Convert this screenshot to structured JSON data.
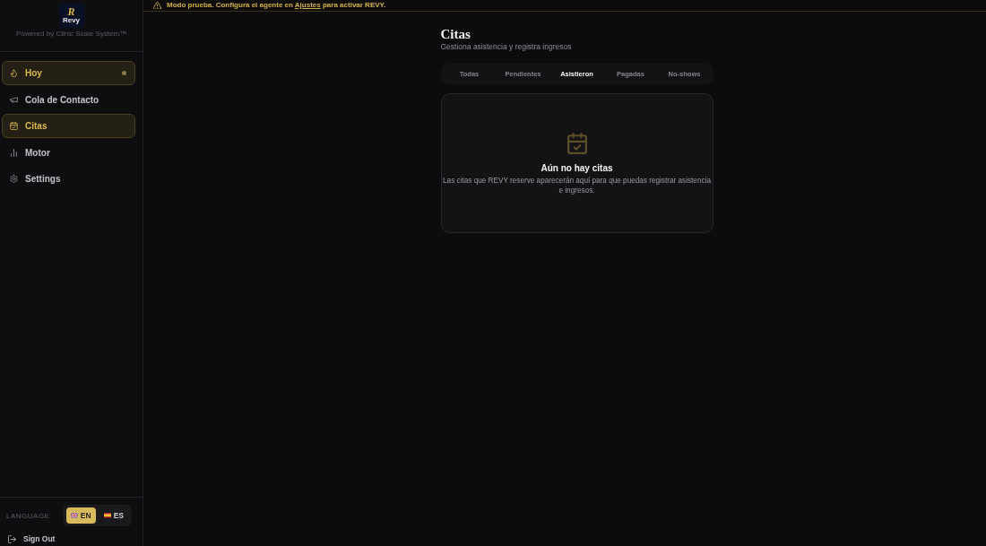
{
  "banner": {
    "message": "**Modo prueba.** Configura el agente en",
    "link": "Ajustes",
    "message_end": "para activar REVY."
  },
  "sidebar": {
    "logo": {
      "mark": "R",
      "name": "Revy"
    },
    "powered_by": "Powered by Clinic Scale System™",
    "nav": [
      {
        "label": "Hoy",
        "selected": true,
        "indicator": true
      },
      {
        "label": "Cola de Contacto",
        "selected": false,
        "indicator": false
      },
      {
        "label": "Citas",
        "selected": true,
        "indicator": false
      },
      {
        "label": "Motor",
        "selected": false,
        "indicator": false
      },
      {
        "label": "Settings",
        "selected": false,
        "indicator": false
      }
    ],
    "language": {
      "label": "LANGUAGE",
      "options": [
        {
          "code": "EN",
          "selected": true
        },
        {
          "code": "ES",
          "selected": false
        }
      ]
    },
    "sign_out": "Sign Out"
  },
  "page": {
    "title": "Citas",
    "subtitle": "Gestiona asistencia y registra ingresos"
  },
  "tabs": [
    {
      "label": "Todas",
      "selected": false
    },
    {
      "label": "Pendientes",
      "selected": false
    },
    {
      "label": "Asistieron",
      "selected": true
    },
    {
      "label": "Pagadas",
      "selected": false
    },
    {
      "label": "No-shows",
      "selected": false
    }
  ],
  "empty_state": {
    "title": "Aún no hay citas",
    "text": "Las citas que REVY reserve aparecerán aquí para que puedas registrar asistencia e ingresos."
  }
}
